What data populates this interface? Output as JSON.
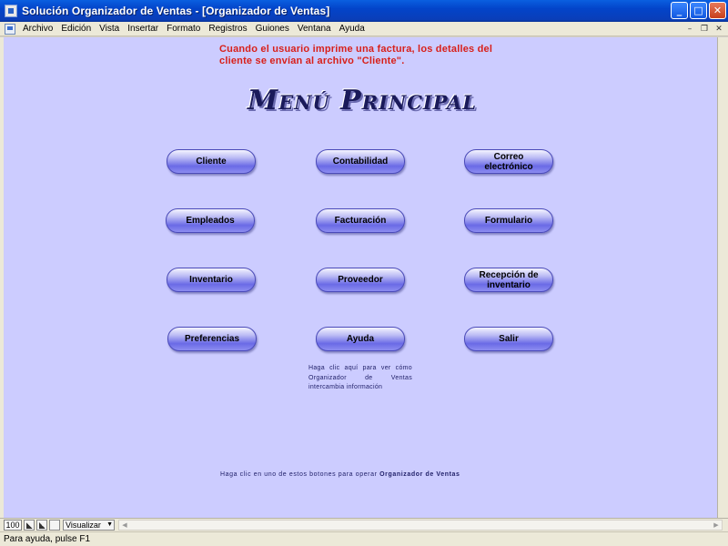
{
  "window": {
    "title": "Solución Organizador de Ventas - [Organizador de Ventas]",
    "controls": {
      "minimize": "_",
      "maximize": "□",
      "close": "✕"
    }
  },
  "menubar": {
    "items": [
      "Archivo",
      "Edición",
      "Vista",
      "Insertar",
      "Formato",
      "Registros",
      "Guiones",
      "Ventana",
      "Ayuda"
    ],
    "mdi_controls": {
      "minimize": "–",
      "restore": "❐",
      "close": "✕"
    }
  },
  "content": {
    "notice": "Cuando el usuario imprime una factura, los detalles del cliente se envían al archivo \"Cliente\".",
    "menu_title": "Menú Principal",
    "buttons": {
      "cliente": "Cliente",
      "contabilidad": "Contabilidad",
      "correo": "Correo electrónico",
      "empleados": "Empleados",
      "facturacion": "Facturación",
      "formulario": "Formulario",
      "inventario": "Inventario",
      "proveedor": "Proveedor",
      "recepcion": "Recepción de inventario",
      "preferencias": "Preferencias",
      "ayuda": "Ayuda",
      "salir": "Salir"
    },
    "help_link": "Haga clic aquí para ver cómo Organizador de Ventas intercambia información",
    "footer_prefix": "Haga clic en uno de estos botones para operar",
    "footer_app": "Organizador de Ventas"
  },
  "bottombar": {
    "zoom": "100",
    "view_mode": "Visualizar"
  },
  "statusbar": {
    "text": "Para ayuda, pulse F1"
  }
}
